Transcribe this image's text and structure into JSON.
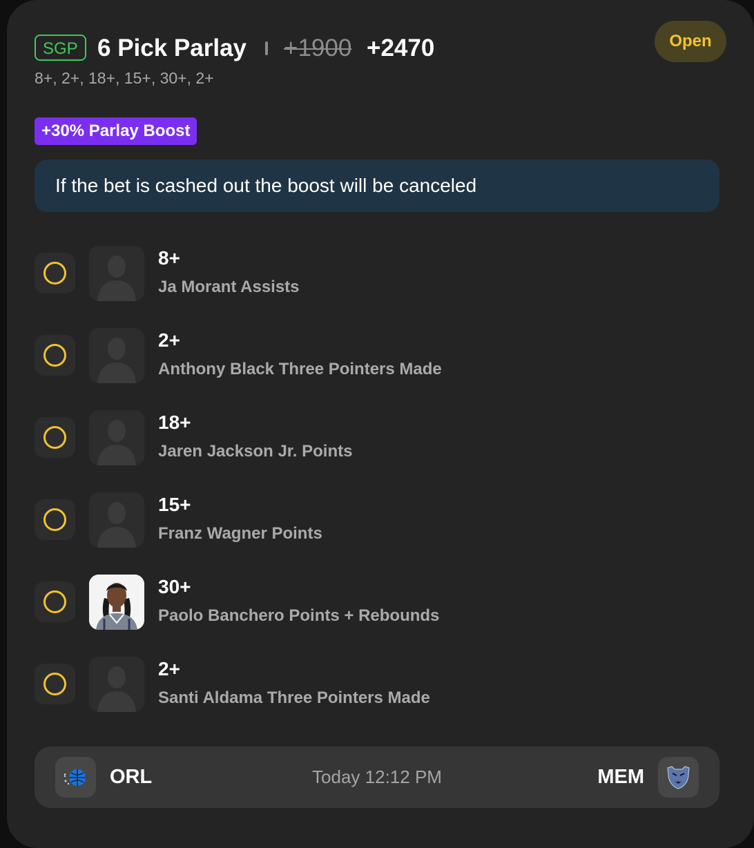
{
  "bet": {
    "badge": "SGP",
    "title": "6 Pick Parlay",
    "old_odds": "+1900",
    "new_odds": "+2470",
    "status": "Open",
    "summary": "8+, 2+, 18+, 15+, 30+, 2+"
  },
  "boost": {
    "label": "+30% Parlay Boost",
    "note": "If the bet is cashed out the boost will be canceled"
  },
  "legs": [
    {
      "line": "8+",
      "market": "Ja Morant Assists",
      "avatar": "silhouette-placeholder"
    },
    {
      "line": "2+",
      "market": "Anthony Black Three Pointers Made",
      "avatar": "silhouette-placeholder"
    },
    {
      "line": "18+",
      "market": "Jaren Jackson Jr. Points",
      "avatar": "silhouette-placeholder"
    },
    {
      "line": "15+",
      "market": "Franz Wagner Points",
      "avatar": "silhouette-placeholder"
    },
    {
      "line": "30+",
      "market": "Paolo Banchero Points + Rebounds",
      "avatar": "player-photo"
    },
    {
      "line": "2+",
      "market": "Santi Aldama Three Pointers Made",
      "avatar": "silhouette-placeholder"
    }
  ],
  "game": {
    "home_team": "ORL",
    "away_team": "MEM",
    "time": "Today 12:12 PM"
  },
  "colors": {
    "card_bg": "#242424",
    "sgp_green": "#3ec95a",
    "open_yellow": "#f2c230",
    "boost_purple": "#7a2ff0",
    "note_bg": "#1f3445"
  }
}
